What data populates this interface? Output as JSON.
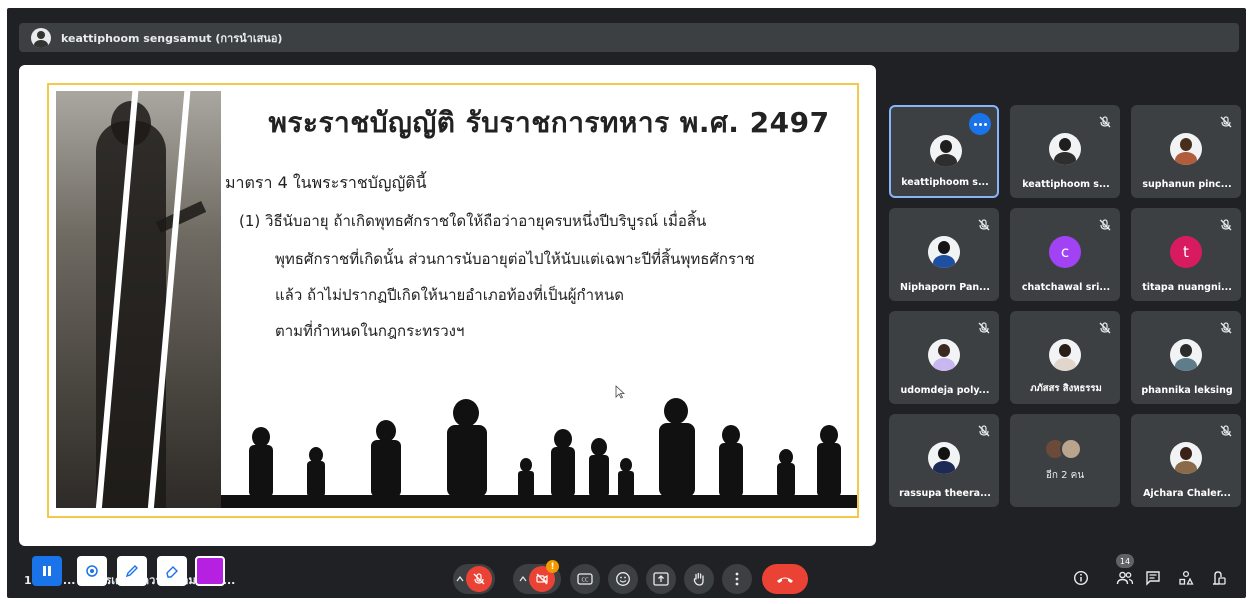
{
  "presenter": {
    "name": "keattiphoom sengsamut (การนำเสนอ)"
  },
  "slide": {
    "title": "พระราชบัญญัติ รับราชการทหาร พ.ศ. 2497",
    "section": "มาตรา 4 ในพระราชบัญญัตินี้",
    "lines": [
      "(1) วิธีนับอายุ ถ้าเกิดพุทธศักราชใดให้ถือว่าอายุครบหนึ่งปีบริบูรณ์ เมื่อสิ้น",
      "พุทธศักราชที่เกิดนั้น ส่วนการนับอายุต่อไปให้นับแต่เฉพาะปีที่สิ้นพุทธศักราช",
      "แล้ว ถ้าไม่ปรากฏปีเกิดให้นายอำเภอท้องที่เป็นผู้กำหนด",
      "ตามที่กำหนดในกฎกระทรวงฯ"
    ]
  },
  "participants": [
    {
      "name": "keattiphoom s...",
      "avatar": "photo",
      "active": true
    },
    {
      "name": "keattiphoom s...",
      "avatar": "photo",
      "muted": true
    },
    {
      "name": "suphanun pinc...",
      "avatar": "photo",
      "muted": true
    },
    {
      "name": "Niphaporn Pan...",
      "avatar": "photo",
      "muted": true
    },
    {
      "name": "chatchawal sri...",
      "avatar": "letter",
      "letter": "c",
      "color": "#a142f4",
      "muted": true
    },
    {
      "name": "titapa nuangni...",
      "avatar": "letter",
      "letter": "t",
      "color": "#d81b60",
      "muted": true
    },
    {
      "name": "udomdeja poly...",
      "avatar": "photo",
      "muted": true
    },
    {
      "name": "ภภัสสร สิงหธรรม",
      "avatar": "photo",
      "muted": true
    },
    {
      "name": "phannika leksing",
      "avatar": "photo",
      "muted": true
    },
    {
      "name": "rassupa theera...",
      "avatar": "photo",
      "muted": true
    },
    {
      "group_label": "อีก 2 คน"
    },
    {
      "name": "Ajchara Chaler...",
      "avatar": "photo",
      "muted": true
    }
  ],
  "meeting": {
    "title": "1 ... ม ... ): การเตรียมความพร้อมของนั...",
    "participant_count": "14"
  },
  "colors": {
    "background": "#202124",
    "tile": "#3c4043",
    "accent": "#1a73e8",
    "end_call": "#ea4335",
    "slide_border": "#f3c94c",
    "annotation_color": "#b620e0"
  }
}
